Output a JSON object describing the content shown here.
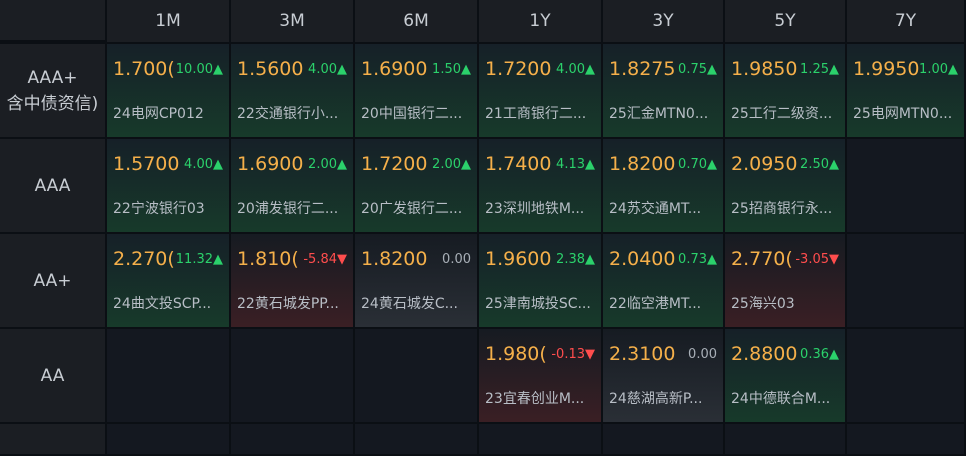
{
  "columns": [
    "1M",
    "3M",
    "6M",
    "1Y",
    "3Y",
    "5Y",
    "7Y"
  ],
  "rows": [
    {
      "label_line1": "AAA+",
      "label_line2": "含中债资信)",
      "cells": [
        {
          "yield": "1.700(",
          "change": "10.00▲",
          "dir": "up",
          "name": "24电网CP012"
        },
        {
          "yield": "1.5600",
          "change": "4.00▲",
          "dir": "up",
          "name": "22交通银行小..."
        },
        {
          "yield": "1.6900",
          "change": "1.50▲",
          "dir": "up",
          "name": "20中国银行二..."
        },
        {
          "yield": "1.7200",
          "change": "4.00▲",
          "dir": "up",
          "name": "21工商银行二..."
        },
        {
          "yield": "1.8275",
          "change": "0.75▲",
          "dir": "up",
          "name": "25汇金MTN0..."
        },
        {
          "yield": "1.9850",
          "change": "1.25▲",
          "dir": "up",
          "name": "25工行二级资..."
        },
        {
          "yield": "1.9950",
          "change": "1.00▲",
          "dir": "up",
          "name": "25电网MTN0..."
        }
      ]
    },
    {
      "label_line1": "AAA",
      "label_line2": "",
      "cells": [
        {
          "yield": "1.5700",
          "change": "4.00▲",
          "dir": "up",
          "name": "22宁波银行03"
        },
        {
          "yield": "1.6900",
          "change": "2.00▲",
          "dir": "up",
          "name": "20浦发银行二..."
        },
        {
          "yield": "1.7200",
          "change": "2.00▲",
          "dir": "up",
          "name": "20广发银行二..."
        },
        {
          "yield": "1.7400",
          "change": "4.13▲",
          "dir": "up",
          "name": "23深圳地铁M..."
        },
        {
          "yield": "1.8200",
          "change": "0.70▲",
          "dir": "up",
          "name": "24苏交通MT..."
        },
        {
          "yield": "2.0950",
          "change": "2.50▲",
          "dir": "up",
          "name": "25招商银行永..."
        },
        null
      ]
    },
    {
      "label_line1": "AA+",
      "label_line2": "",
      "cells": [
        {
          "yield": "2.270(",
          "change": "11.32▲",
          "dir": "up",
          "name": "24曲文投SCP..."
        },
        {
          "yield": "1.810(",
          "change": "-5.84▼",
          "dir": "down",
          "name": "22黄石城发PP..."
        },
        {
          "yield": "1.8200",
          "change": "0.00",
          "dir": "flat",
          "name": "24黄石城发C..."
        },
        {
          "yield": "1.9600",
          "change": "2.38▲",
          "dir": "up",
          "name": "25津南城投SC..."
        },
        {
          "yield": "2.0400",
          "change": "0.73▲",
          "dir": "up",
          "name": "22临空港MT..."
        },
        {
          "yield": "2.770(",
          "change": "-3.05▼",
          "dir": "down",
          "name": "25海兴03"
        },
        null
      ]
    },
    {
      "label_line1": "AA",
      "label_line2": "",
      "cells": [
        null,
        null,
        null,
        {
          "yield": "1.980(",
          "change": "-0.13▼",
          "dir": "down",
          "name": "23宜春创业M..."
        },
        {
          "yield": "2.3100",
          "change": "0.00",
          "dir": "flat",
          "name": "24慈湖高新P..."
        },
        {
          "yield": "2.8800",
          "change": "0.36▲",
          "dir": "up",
          "name": "24中德联合M..."
        },
        null
      ]
    },
    {
      "label_line1": "",
      "label_line2": "",
      "cells": [
        null,
        null,
        null,
        null,
        null,
        null,
        null
      ]
    }
  ]
}
